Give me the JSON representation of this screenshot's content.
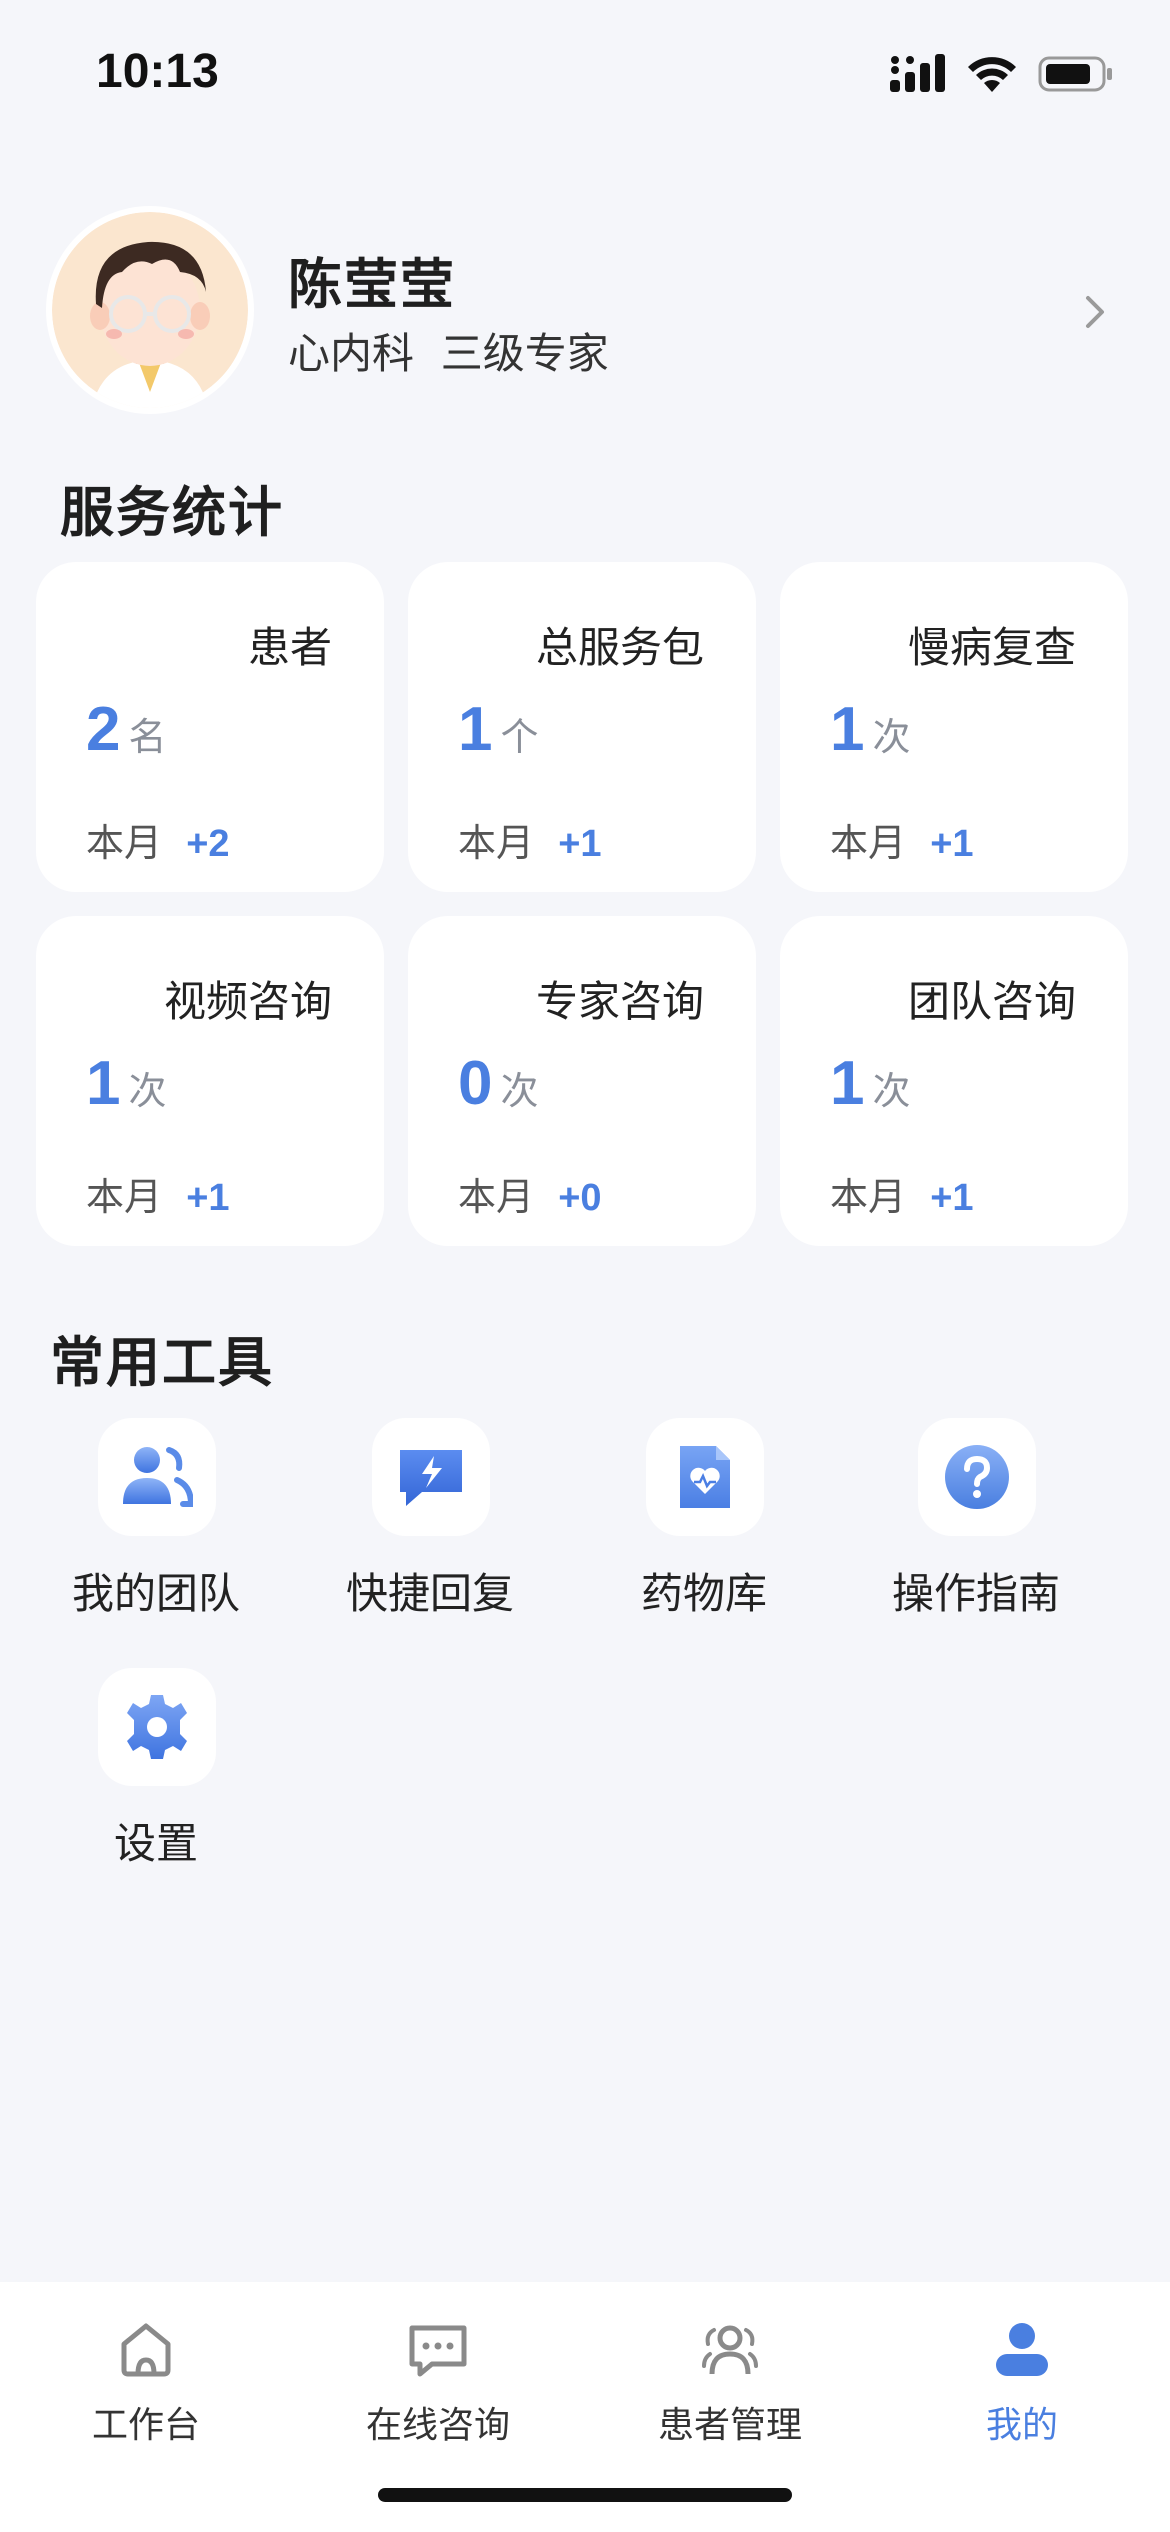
{
  "status_bar": {
    "time": "10:13"
  },
  "profile": {
    "name": "陈莹莹",
    "title": "心内科  三级专家"
  },
  "stats": {
    "title": "服务统计",
    "month_label": "本月",
    "items": [
      {
        "label": "患者",
        "value": "2",
        "unit": "名",
        "delta": "+2"
      },
      {
        "label": "总服务包",
        "value": "1",
        "unit": "个",
        "delta": "+1"
      },
      {
        "label": "慢病复查",
        "value": "1",
        "unit": "次",
        "delta": "+1"
      },
      {
        "label": "视频咨询",
        "value": "1",
        "unit": "次",
        "delta": "+1"
      },
      {
        "label": "专家咨询",
        "value": "0",
        "unit": "次",
        "delta": "+0"
      },
      {
        "label": "团队咨询",
        "value": "1",
        "unit": "次",
        "delta": "+1"
      }
    ]
  },
  "tools": {
    "title": "常用工具",
    "items": [
      {
        "label": "我的团队",
        "icon": "team-icon"
      },
      {
        "label": "快捷回复",
        "icon": "quick-reply-icon"
      },
      {
        "label": "药物库",
        "icon": "drug-library-icon"
      },
      {
        "label": "操作指南",
        "icon": "help-icon"
      },
      {
        "label": "设置",
        "icon": "settings-icon"
      }
    ]
  },
  "tab_bar": {
    "tabs": [
      {
        "label": "工作台",
        "icon": "home-icon",
        "active": false
      },
      {
        "label": "在线咨询",
        "icon": "chat-icon",
        "active": false
      },
      {
        "label": "患者管理",
        "icon": "patients-icon",
        "active": false
      },
      {
        "label": "我的",
        "icon": "user-icon",
        "active": true
      }
    ]
  },
  "colors": {
    "accent": "#4a7fe0",
    "background": "#f5f6fa",
    "card": "#ffffff"
  }
}
